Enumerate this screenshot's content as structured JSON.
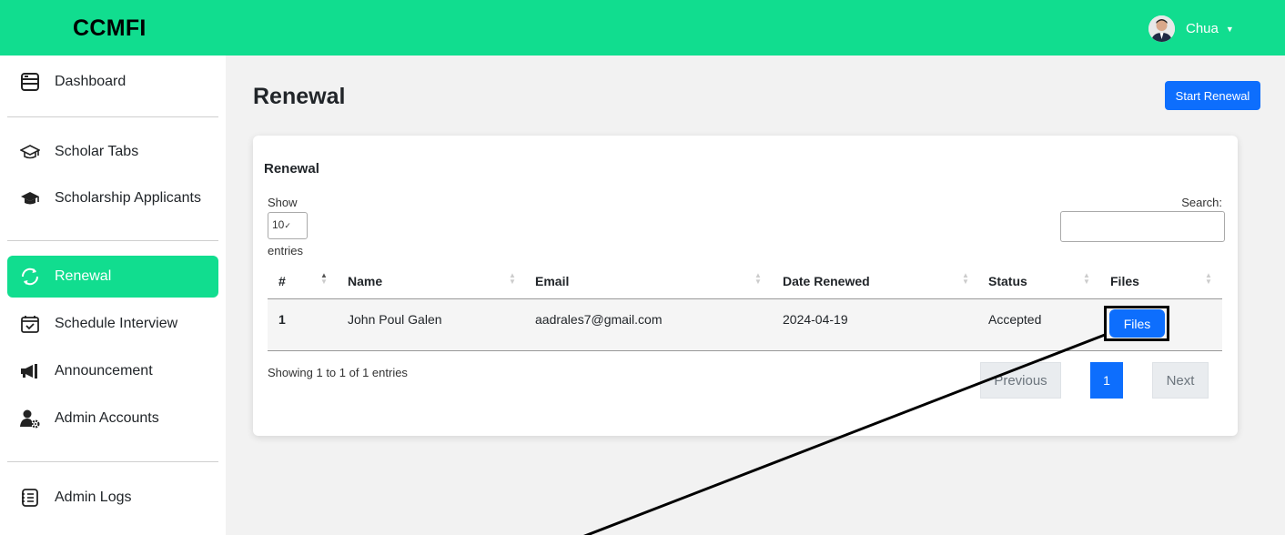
{
  "app": {
    "brand": "CCMFI",
    "user_name": "Chua"
  },
  "sidebar": {
    "items": [
      {
        "label": "Dashboard",
        "icon": "dashboard-icon"
      },
      {
        "label": "Scholar Tabs",
        "icon": "graduation-cap-outline-icon"
      },
      {
        "label": "Scholarship Applicants",
        "icon": "graduation-cap-icon"
      },
      {
        "label": "Renewal",
        "icon": "refresh-icon",
        "active": true
      },
      {
        "label": "Schedule Interview",
        "icon": "calendar-check-icon"
      },
      {
        "label": "Announcement",
        "icon": "megaphone-icon"
      },
      {
        "label": "Admin Accounts",
        "icon": "user-gear-icon"
      },
      {
        "label": "Admin Logs",
        "icon": "log-list-icon"
      }
    ]
  },
  "page": {
    "title": "Renewal",
    "start_button": "Start Renewal"
  },
  "card": {
    "title": "Renewal",
    "show_label": "Show",
    "length_value": "10",
    "entries_label": "entries",
    "search_label": "Search:",
    "columns": [
      "#",
      "Name",
      "Email",
      "Date Renewed",
      "Status",
      "Files"
    ],
    "rows": [
      {
        "num": "1",
        "name": "John Poul Galen",
        "email": "aadrales7@gmail.com",
        "date": "2024-04-19",
        "status": "Accepted",
        "files_button": "Files"
      }
    ],
    "info": "Showing 1 to 1 of 1 entries",
    "pagination": {
      "prev": "Previous",
      "page": "1",
      "next": "Next"
    }
  },
  "colors": {
    "topbar": "#11dd8f",
    "primary": "#0d6efd",
    "active_nav": "#11dd8f"
  }
}
